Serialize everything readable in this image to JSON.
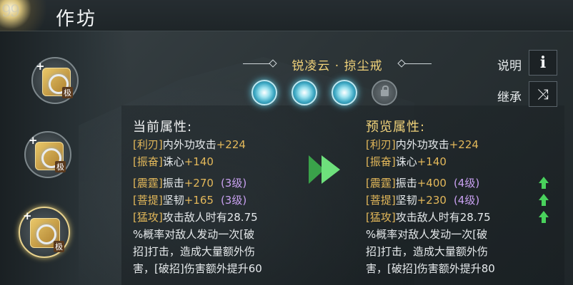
{
  "header": {
    "title": "作坊",
    "deco_text": "99"
  },
  "slots": [
    {
      "tag": "极",
      "icon": "bracelet-icon",
      "selected": false
    },
    {
      "tag": "极",
      "icon": "double-ring-icon",
      "selected": false
    },
    {
      "tag": "极",
      "icon": "ring-icon",
      "selected": true
    }
  ],
  "item": {
    "name": "锐凌云 · 掠尘戒"
  },
  "gems": [
    {
      "icon": "spark-gem-icon",
      "state": "active"
    },
    {
      "icon": "spark-gem-icon",
      "state": "active"
    },
    {
      "icon": "spark-gem-icon",
      "state": "active"
    },
    {
      "icon": "lock-icon",
      "state": "locked"
    }
  ],
  "side_buttons": {
    "info_label": "说明",
    "info_glyph": "i",
    "inherit_label": "继承",
    "inherit_glyph": "⤨"
  },
  "current": {
    "heading": "当前属性:",
    "lines": [
      {
        "tag": "[利刃]",
        "text": "内外功攻击",
        "value": "+224",
        "level": ""
      },
      {
        "tag": "[振奋]",
        "text": "诛心",
        "value": "+140",
        "level": ""
      },
      {
        "tag": "[震霆]",
        "text": "振击",
        "value": "+270",
        "level": "(3级)"
      },
      {
        "tag": "[菩提]",
        "text": "坚韧",
        "value": "+165",
        "level": "(3级)"
      }
    ],
    "desc_lines": [
      {
        "tag": "[猛攻]",
        "text": "攻击敌人时有28.75"
      },
      {
        "tag": "",
        "text": "%概率对敌人发动一次[破"
      },
      {
        "tag": "",
        "text": "招]打击，造成大量额外伤"
      },
      {
        "tag": "",
        "text": "害，[破招]伤害额外提升60"
      }
    ]
  },
  "preview": {
    "heading": "预览属性:",
    "lines": [
      {
        "tag": "[利刃]",
        "text": "内外功攻击",
        "value": "+224",
        "level": ""
      },
      {
        "tag": "[振奋]",
        "text": "诛心",
        "value": "+140",
        "level": ""
      },
      {
        "tag": "[震霆]",
        "text": "振击",
        "value": "+400",
        "level": "(4级)"
      },
      {
        "tag": "[菩提]",
        "text": "坚韧",
        "value": "+230",
        "level": "(4级)"
      }
    ],
    "desc_lines": [
      {
        "tag": "[猛攻]",
        "text": "攻击敌人时有28.75"
      },
      {
        "tag": "",
        "text": "%概率对敌人发动一次[破"
      },
      {
        "tag": "",
        "text": "招]打击，造成大量额外伤"
      },
      {
        "tag": "",
        "text": "害，[破招]伤害额外提升80"
      }
    ]
  },
  "colors": {
    "accent_gold": "#f0d27a",
    "tag_gold": "#e3b85a",
    "level_purple": "#c8a0f0",
    "upgrade_green": "#49d15c"
  }
}
